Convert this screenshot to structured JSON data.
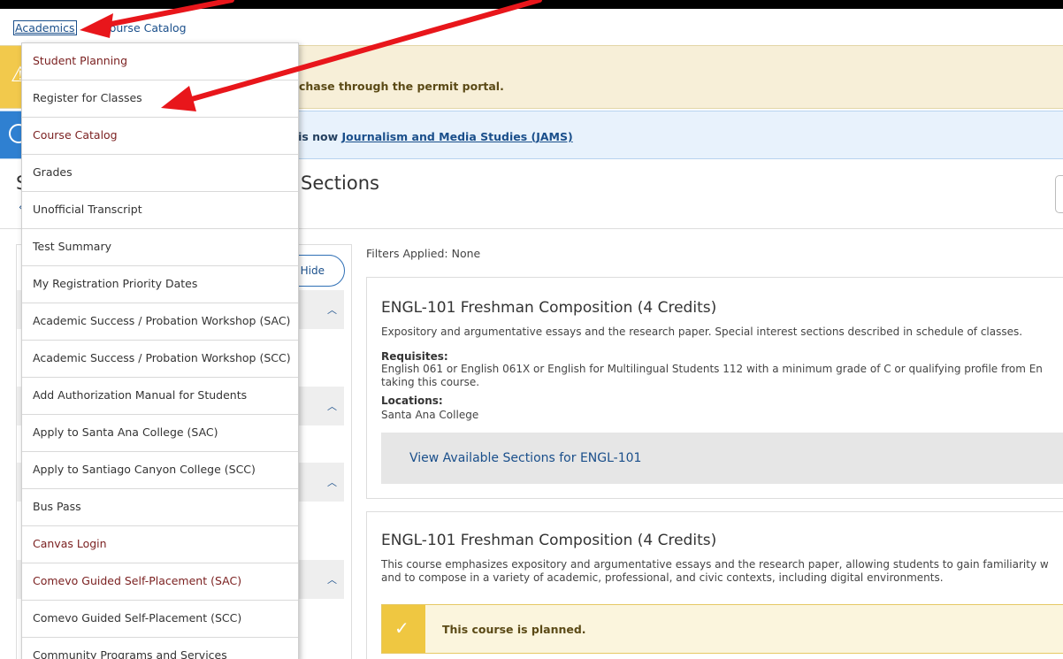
{
  "breadcrumb": {
    "academics": "Academics",
    "current": "Course Catalog"
  },
  "banners": {
    "warning_text": "chase through the permit portal.",
    "info_prefix": ") is now ",
    "info_link": "Journalism and Media Studies (JAMS)"
  },
  "page": {
    "title_left": "S",
    "title_right": "Sections"
  },
  "filters": {
    "hide_label": "Hide",
    "applied_label": "Filters Applied: None"
  },
  "menu": {
    "items": [
      {
        "label": "Student Planning",
        "color": "#7a1f1f"
      },
      {
        "label": "Register for Classes",
        "color": "#333333"
      },
      {
        "label": "Course Catalog",
        "color": "#7a1f1f"
      },
      {
        "label": "Grades",
        "color": "#333333"
      },
      {
        "label": "Unofficial Transcript",
        "color": "#333333"
      },
      {
        "label": "Test Summary",
        "color": "#333333"
      },
      {
        "label": "My Registration Priority Dates",
        "color": "#333333"
      },
      {
        "label": "Academic Success / Probation Workshop (SAC)",
        "color": "#333333"
      },
      {
        "label": "Academic Success / Probation Workshop (SCC)",
        "color": "#333333"
      },
      {
        "label": "Add Authorization Manual for Students",
        "color": "#333333"
      },
      {
        "label": "Apply to Santa Ana College (SAC)",
        "color": "#333333"
      },
      {
        "label": "Apply to Santiago Canyon College (SCC)",
        "color": "#333333"
      },
      {
        "label": "Bus Pass",
        "color": "#333333"
      },
      {
        "label": "Canvas Login",
        "color": "#7a1f1f"
      },
      {
        "label": "Comevo Guided Self-Placement (SAC)",
        "color": "#7a1f1f"
      },
      {
        "label": "Comevo Guided Self-Placement (SCC)",
        "color": "#333333"
      },
      {
        "label": "Community Programs and Services",
        "color": "#333333"
      }
    ]
  },
  "courses": [
    {
      "title": "ENGL-101 Freshman Composition (4 Credits)",
      "description": "Expository and argumentative essays and the research paper. Special interest sections described in schedule of classes.",
      "requisites_label": "Requisites:",
      "requisites_text": "English 061 or English 061X or English for Multilingual Students 112 with a minimum grade of C or qualifying profile from En",
      "requisites_text2": "taking this course.",
      "locations_label": "Locations:",
      "locations_text": "Santa Ana College",
      "view_sections": "View Available Sections for ENGL-101"
    },
    {
      "title": "ENGL-101 Freshman Composition (4 Credits)",
      "description": "This course emphasizes expository and argumentative essays and the research paper, allowing students to gain familiarity w and to compose in a variety of academic, professional, and civic contexts, including digital environments.",
      "planned_text": "This course is planned."
    }
  ],
  "colors": {
    "annotation_arrow": "#e8161b",
    "link": "#1a4f8b",
    "warning": "#f2c94c",
    "info": "#2f80d1"
  }
}
